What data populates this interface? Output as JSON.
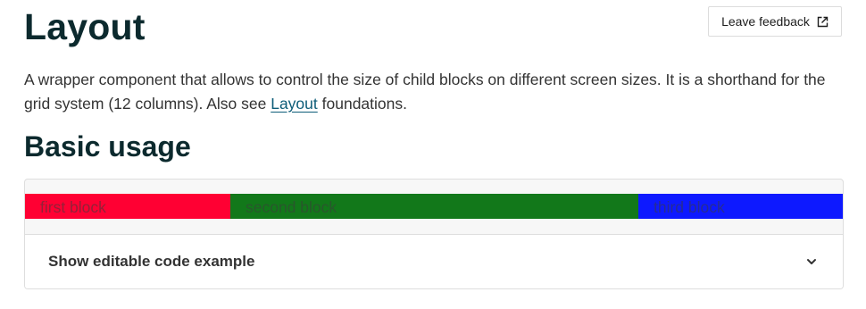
{
  "header": {
    "title": "Layout",
    "feedback_label": "Leave feedback",
    "feedback_icon": "external-link-icon"
  },
  "intro": {
    "text_before": "A wrapper component that allows to control the size of child blocks on different screen sizes. It is a shorthand for the grid system (12 columns). Also see ",
    "link_text": "Layout",
    "text_after": " foundations."
  },
  "section": {
    "title": "Basic usage"
  },
  "example": {
    "blocks": [
      {
        "label": "first block",
        "color": "#ff0033"
      },
      {
        "label": "second block",
        "color": "#12781a"
      },
      {
        "label": "third block",
        "color": "#0d19ff"
      }
    ],
    "code_toggle_label": "Show editable code example",
    "code_toggle_icon": "chevron-down-icon"
  },
  "colors": {
    "heading": "#0c2a2e",
    "link": "#0d5c78"
  }
}
